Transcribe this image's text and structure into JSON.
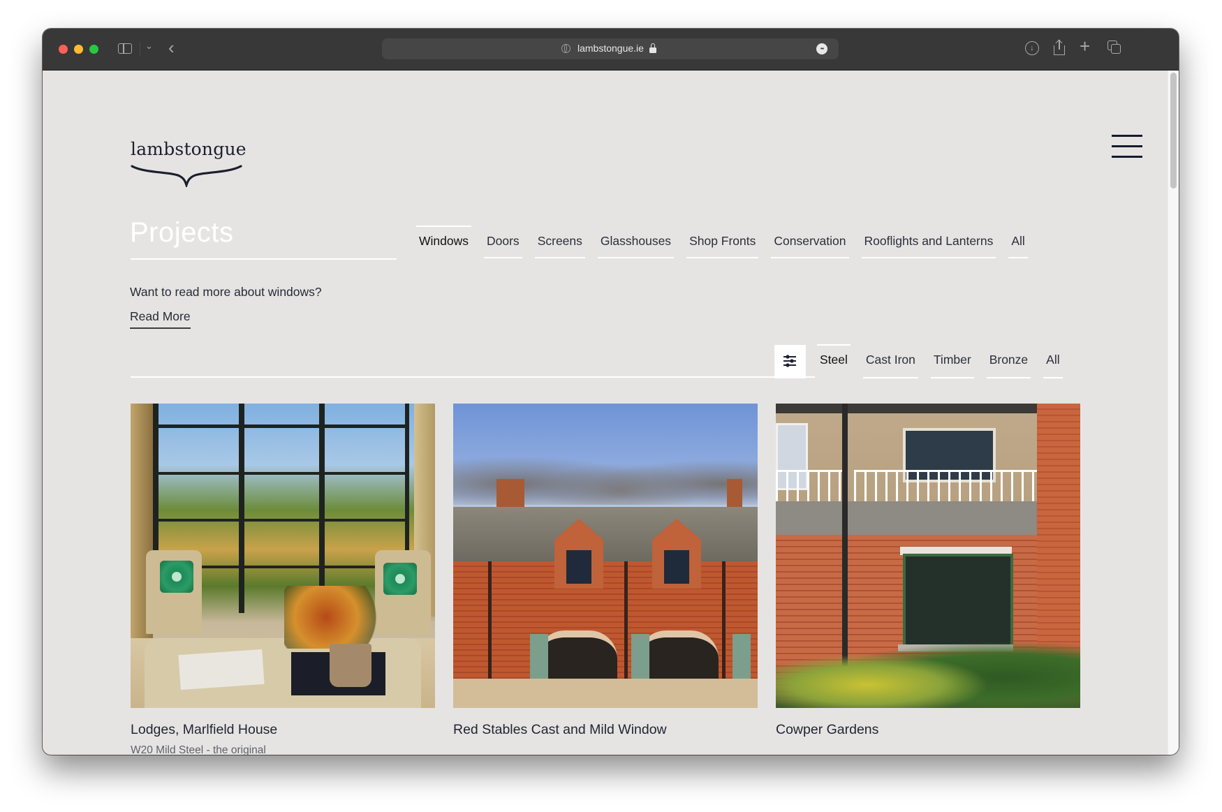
{
  "browser": {
    "url": "lambstongue.ie",
    "icons": {
      "sidebar": "sidebar-icon",
      "tab_group_menu": "chevron-down-icon",
      "back": "chevron-left-icon",
      "site": "globe-icon",
      "secure": "lock-icon",
      "page_menu": "ellipsis-icon",
      "downloads": "download-icon",
      "share": "share-icon",
      "new_tab": "plus-icon",
      "tab_overview": "tabs-icon"
    },
    "back_glyph": "‹",
    "new_tab_glyph": "+",
    "more_glyph": "•••",
    "download_glyph": "↓"
  },
  "header": {
    "logo_text": "lambstongue",
    "menu_icon": "hamburger-icon"
  },
  "page": {
    "title": "Projects",
    "category_tabs": [
      {
        "label": "Windows",
        "active": true
      },
      {
        "label": "Doors",
        "active": false
      },
      {
        "label": "Screens",
        "active": false
      },
      {
        "label": "Glasshouses",
        "active": false
      },
      {
        "label": "Shop Fronts",
        "active": false
      },
      {
        "label": "Conservation",
        "active": false
      },
      {
        "label": "Rooflights and Lanterns",
        "active": false
      },
      {
        "label": "All",
        "active": false
      }
    ],
    "intro_text": "Want to read more about windows?",
    "read_more_label": "Read More",
    "filter_icon": "sliders-icon",
    "material_tabs": [
      {
        "label": "Steel",
        "active": true
      },
      {
        "label": "Cast Iron",
        "active": false
      },
      {
        "label": "Timber",
        "active": false
      },
      {
        "label": "Bronze",
        "active": false
      },
      {
        "label": "All",
        "active": false
      }
    ],
    "projects": [
      {
        "title": "Lodges, Marlfield House",
        "subtitle": "W20 Mild Steel - the original",
        "image": "interior with black steel-framed glazed screen, armchairs and autumn flowers"
      },
      {
        "title": "Red Stables Cast and Mild Window",
        "subtitle": "",
        "image": "red brick stable building with dormer windows and green doors"
      },
      {
        "title": "Cowper Gardens",
        "subtitle": "",
        "image": "brick house with green steel bay window and white balcony railing"
      }
    ]
  },
  "colors": {
    "page_bg": "#e6e4e3",
    "text_dark": "#222633",
    "accent_white": "#ffffff",
    "titlebar": "#383838"
  }
}
